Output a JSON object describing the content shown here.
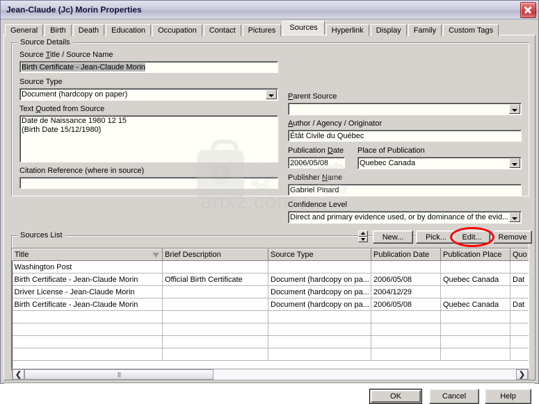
{
  "window": {
    "title": "Jean-Claude (Jc) Morin Properties",
    "close_icon": "close-icon"
  },
  "tabs": [
    {
      "label": "General",
      "active": false
    },
    {
      "label": "Birth",
      "active": false
    },
    {
      "label": "Death",
      "active": false
    },
    {
      "label": "Education",
      "active": false
    },
    {
      "label": "Occupation",
      "active": false
    },
    {
      "label": "Contact",
      "active": false
    },
    {
      "label": "Pictures",
      "active": false
    },
    {
      "label": "Sources",
      "active": true
    },
    {
      "label": "Hyperlink",
      "active": false
    },
    {
      "label": "Display",
      "active": false
    },
    {
      "label": "Family",
      "active": false
    },
    {
      "label": "Custom Tags",
      "active": false
    }
  ],
  "source_details": {
    "group_title": "Source Details",
    "source_title_label": "Source Title / Source Name",
    "source_title_value": "Birth Certificate - Jean-Claude Morin",
    "source_type_label": "Source Type",
    "source_type_value": "Document (hardcopy on paper)",
    "text_quoted_label": "Text Quoted from Source",
    "text_quoted_value": "Date de Naissance 1980 12 15\n(Birth Date 15/12/1980)",
    "citation_reference_label": "Citation Reference (where in source)",
    "citation_reference_value": "",
    "parent_source_label": "Parent Source",
    "parent_source_value": "",
    "author_label": "Author / Agency / Originator",
    "author_value": "Étât Civile du Québec",
    "publication_date_label": "Publication Date",
    "publication_date_value": "2006/05/08",
    "place_of_publication_label": "Place of Publication",
    "place_of_publication_value": "Quebec Canada",
    "publisher_name_label": "Publisher Name",
    "publisher_name_value": "Gabriel Pinard",
    "confidence_level_label": "Confidence Level",
    "confidence_level_value": "Direct and primary evidence used, or by dominance of the evid..."
  },
  "sources_list": {
    "group_title": "Sources List",
    "buttons": [
      {
        "name": "new",
        "label": "New..."
      },
      {
        "name": "pick",
        "label": "Pick..."
      },
      {
        "name": "edit",
        "label": "Edit..."
      },
      {
        "name": "remove",
        "label": "Remove"
      }
    ],
    "columns": [
      {
        "label": "Title",
        "sorted": true
      },
      {
        "label": "Brief Description",
        "sorted": false
      },
      {
        "label": "Source Type",
        "sorted": false
      },
      {
        "label": "Publication Date",
        "sorted": false
      },
      {
        "label": "Publication Place",
        "sorted": false
      },
      {
        "label": "Quo",
        "sorted": false
      }
    ],
    "rows": [
      [
        "Washington Post",
        "",
        "",
        "",
        "",
        ""
      ],
      [
        "Birth Certificate - Jean-Claude Morin",
        "Official Birth Certificate",
        "Document (hardcopy on pa...",
        "2006/05/08",
        "Quebec Canada",
        "Dat"
      ],
      [
        "Driver License - Jean-Claude Morin",
        "",
        "Document (hardcopy on pa...",
        "2004/12/29",
        "",
        ""
      ],
      [
        "Birth Certificate - Jean-Claude Morin",
        "",
        "Document (hardcopy on pa...",
        "2006/05/08",
        "Quebec Canada",
        "Dat"
      ],
      [
        "",
        "",
        "",
        "",
        "",
        ""
      ],
      [
        "",
        "",
        "",
        "",
        "",
        ""
      ],
      [
        "",
        "",
        "",
        "",
        "",
        ""
      ],
      [
        "",
        "",
        "",
        "",
        "",
        ""
      ]
    ],
    "scroll_left_icon": "chevron-left-icon",
    "scroll_right_icon": "chevron-right-icon"
  },
  "dialog_buttons": [
    {
      "name": "ok",
      "label": "OK",
      "default": true
    },
    {
      "name": "cancel",
      "label": "Cancel",
      "default": false
    },
    {
      "name": "help",
      "label": "Help",
      "default": false
    }
  ],
  "watermark": {
    "text": "anxz.com",
    "cn_text": "安下载"
  },
  "colors": {
    "face": "#d6d3ce",
    "field": "#fffff7",
    "annotation": "#ff0000",
    "title_text": "#11113a"
  }
}
